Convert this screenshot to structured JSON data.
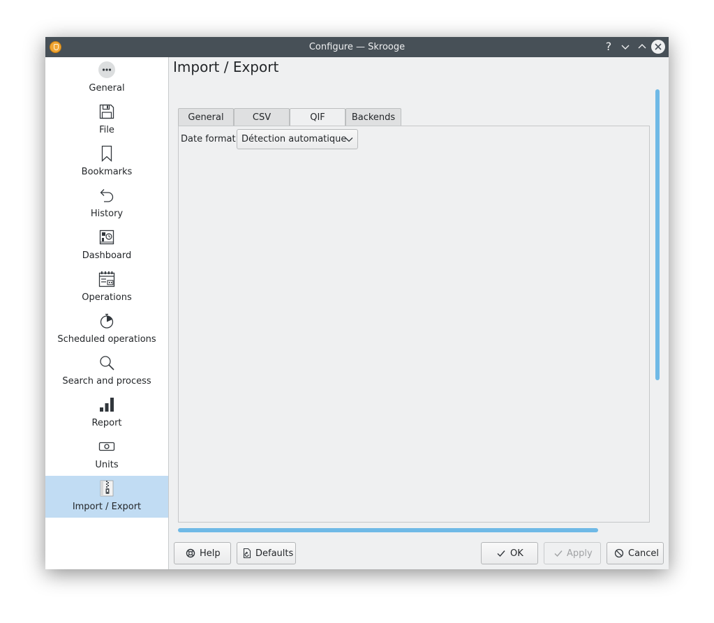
{
  "window": {
    "title": "Configure — Skrooge",
    "help_glyph": "?"
  },
  "sidebar": {
    "items": [
      {
        "label": "General",
        "icon": "more-dots-icon"
      },
      {
        "label": "File",
        "icon": "floppy-save-icon"
      },
      {
        "label": "Bookmarks",
        "icon": "bookmark-icon"
      },
      {
        "label": "History",
        "icon": "undo-history-icon"
      },
      {
        "label": "Dashboard",
        "icon": "dashboard-icon"
      },
      {
        "label": "Operations",
        "icon": "operations-calendar-icon"
      },
      {
        "label": "Scheduled operations",
        "icon": "timer-icon"
      },
      {
        "label": "Search and process",
        "icon": "search-icon"
      },
      {
        "label": "Report",
        "icon": "bar-chart-icon"
      },
      {
        "label": "Units",
        "icon": "banknote-icon"
      },
      {
        "label": "Import / Export",
        "icon": "archive-zip-icon"
      }
    ],
    "selected_index": 10
  },
  "page": {
    "title": "Import / Export",
    "tabs": [
      {
        "label": "General"
      },
      {
        "label": "CSV"
      },
      {
        "label": "QIF"
      },
      {
        "label": "Backends"
      }
    ],
    "active_tab": "QIF",
    "date_format_label": "Date format:",
    "date_format_value": "Détection automatique"
  },
  "buttons": {
    "help": "Help",
    "defaults": "Defaults",
    "ok": "OK",
    "apply": "Apply",
    "cancel": "Cancel"
  },
  "colors": {
    "titlebar": "#475057",
    "selection": "#c1dcf3",
    "scrollbar": "#6fb9e6",
    "app_icon": "#f0a534"
  }
}
